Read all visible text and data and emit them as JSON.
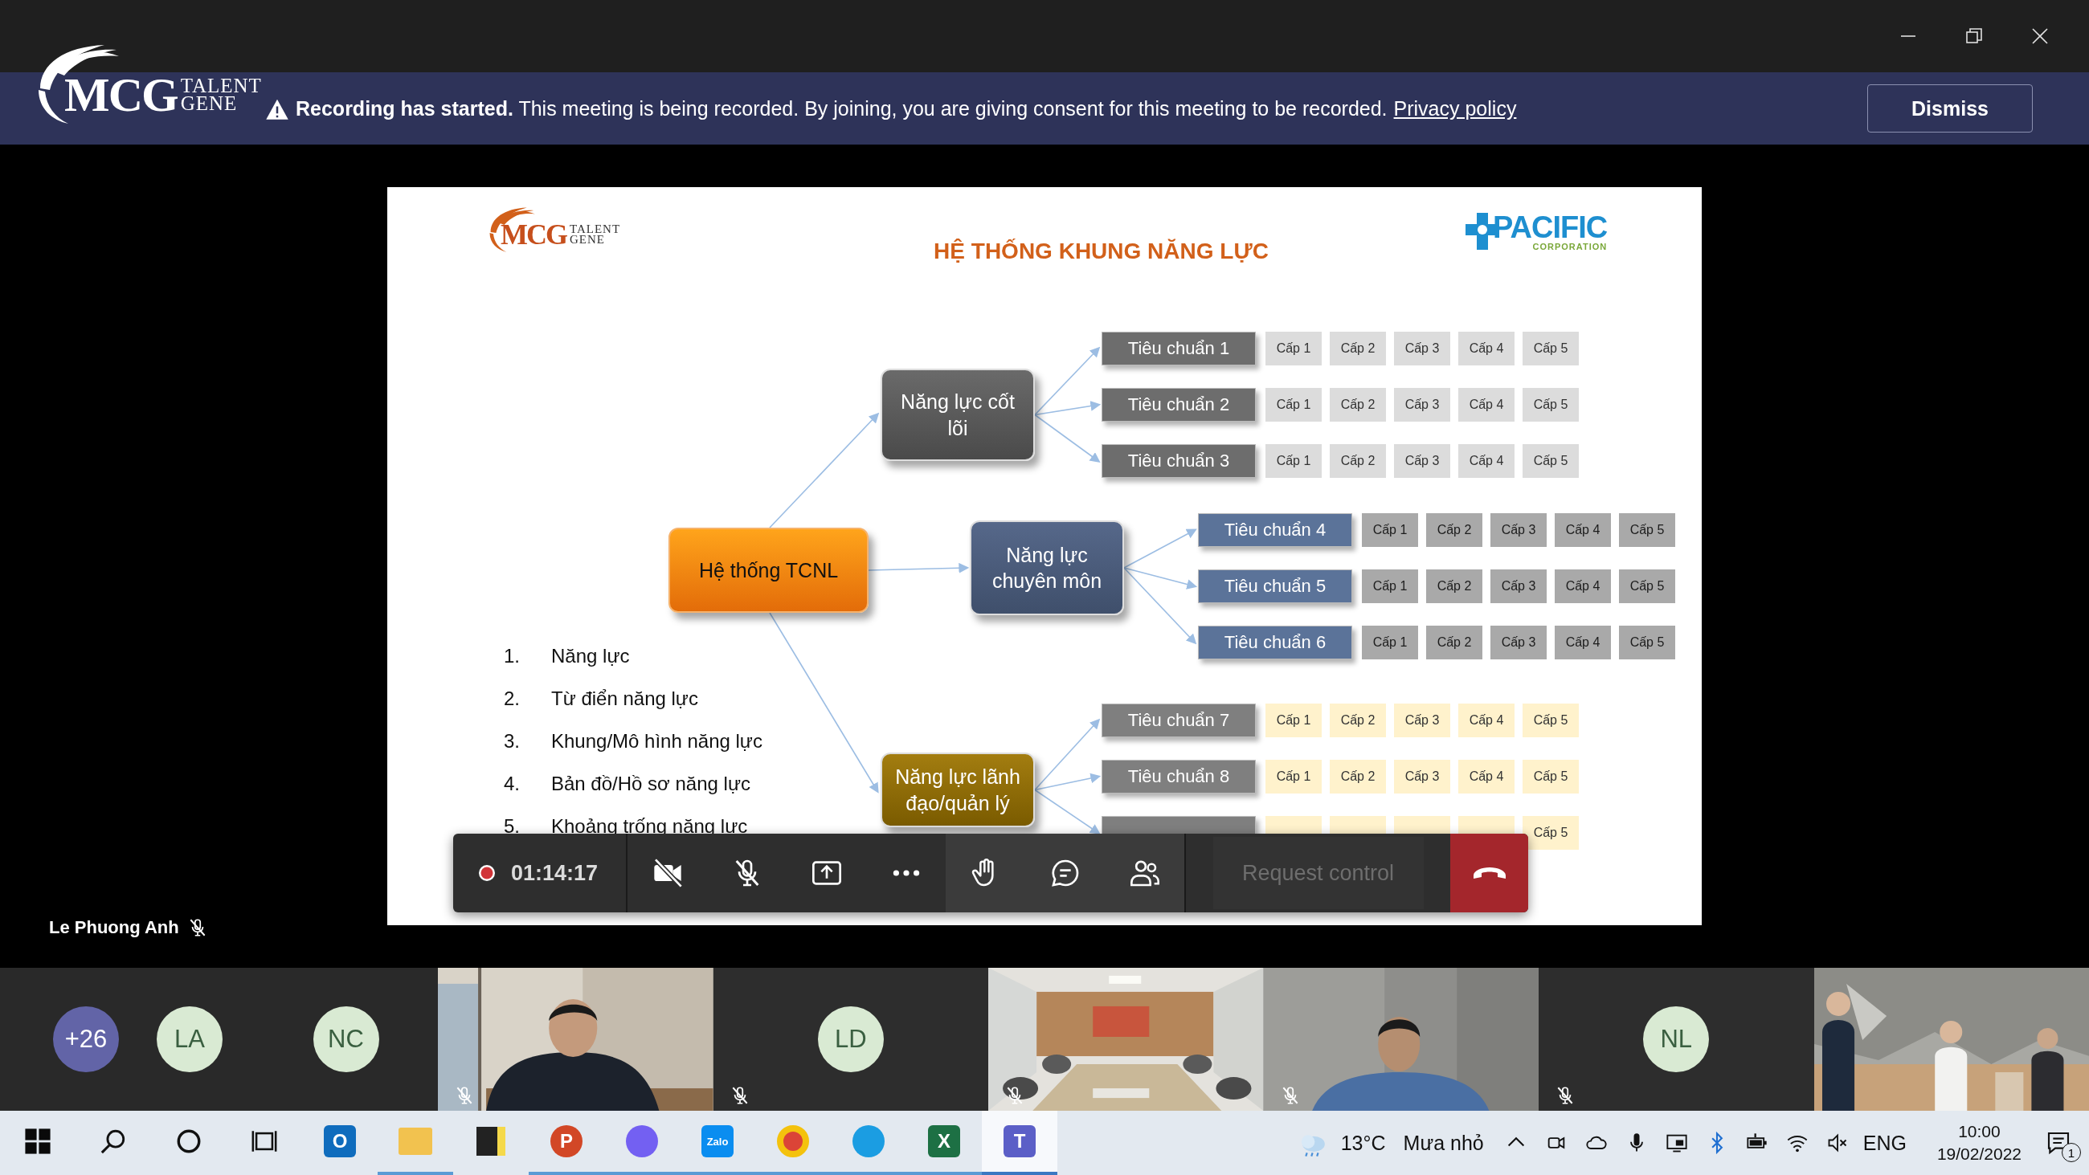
{
  "banner": {
    "logo": {
      "mark": "MCG",
      "line_1": "TALENT",
      "line_2": "GENE"
    },
    "message": "**Recording has started.** This meeting is being recorded. By joining, you are giving consent for this meeting to be recorded.",
    "link": "Privacy policy",
    "button": "Dismiss"
  },
  "slide": {
    "logo": {
      "mark": "MCG",
      "line_1": "TALENT",
      "line_2": "GENE"
    },
    "partner_logo": {
      "name": "PACIFIC",
      "tagline": "CORPORATION"
    },
    "title": "HỆ THỐNG KHUNG NĂNG LỰC",
    "diagram": {
      "root": "Hệ thống TCNL",
      "groups": [
        {
          "kind": "core",
          "label": "Năng lực cốt lõi",
          "standards": [
            {
              "label": "Tiêu chuẩn 1",
              "levels": [
                "Cấp 1",
                "Cấp 2",
                "Cấp 3",
                "Cấp 4",
                "Cấp 5"
              ]
            },
            {
              "label": "Tiêu chuẩn 2",
              "levels": [
                "Cấp 1",
                "Cấp 2",
                "Cấp 3",
                "Cấp 4",
                "Cấp 5"
              ]
            },
            {
              "label": "Tiêu chuẩn 3",
              "levels": [
                "Cấp 1",
                "Cấp 2",
                "Cấp 3",
                "Cấp 4",
                "Cấp 5"
              ]
            }
          ]
        },
        {
          "kind": "professional",
          "label": "Năng lực chuyên môn",
          "standards": [
            {
              "label": "Tiêu chuẩn 4",
              "levels": [
                "Cấp 1",
                "Cấp 2",
                "Cấp 3",
                "Cấp 4",
                "Cấp 5"
              ]
            },
            {
              "label": "Tiêu chuẩn 5",
              "levels": [
                "Cấp 1",
                "Cấp 2",
                "Cấp 3",
                "Cấp 4",
                "Cấp 5"
              ]
            },
            {
              "label": "Tiêu chuẩn 6",
              "levels": [
                "Cấp 1",
                "Cấp 2",
                "Cấp 3",
                "Cấp 4",
                "Cấp 5"
              ]
            }
          ]
        },
        {
          "kind": "leadership",
          "label": "Năng lực lãnh đạo/quản lý",
          "standards": [
            {
              "label": "Tiêu chuẩn 7",
              "levels": [
                "Cấp 1",
                "Cấp 2",
                "Cấp 3",
                "Cấp 4",
                "Cấp 5"
              ]
            },
            {
              "label": "Tiêu chuẩn 8",
              "levels": [
                "Cấp 1",
                "Cấp 2",
                "Cấp 3",
                "Cấp 4",
                "Cấp 5"
              ]
            },
            {
              "levels": [
                "Cấp 5"
              ]
            }
          ]
        }
      ]
    },
    "list": [
      {
        "number": "1.",
        "text": "Năng lực"
      },
      {
        "number": "2.",
        "text": "Từ điển năng lực"
      },
      {
        "number": "3.",
        "text": "Khung/Mô hình năng lực"
      },
      {
        "number": "4.",
        "text": "Bản đồ/Hồ sơ năng lực"
      },
      {
        "number": "5.",
        "text": "Khoảng trống năng lực"
      }
    ]
  },
  "toolbar": {
    "recording": true,
    "timer": "01:14:17",
    "camera_on": false,
    "mic_on": false,
    "request_control": {
      "label": "Request control",
      "disabled": true
    }
  },
  "speaker": {
    "name": "Le Phuong Anh",
    "muted": true
  },
  "participants": [
    {
      "kind": "overflow",
      "label": "+26"
    },
    {
      "kind": "avatar",
      "initials": "LA"
    },
    {
      "kind": "avatar",
      "initials": "NC"
    },
    {
      "kind": "video",
      "muted": true
    },
    {
      "kind": "tile",
      "initials": "LD",
      "muted": true
    },
    {
      "kind": "video",
      "muted": true
    },
    {
      "kind": "video",
      "muted": true
    },
    {
      "kind": "tile",
      "initials": "NL",
      "muted": true
    },
    {
      "kind": "video",
      "muted": false
    }
  ],
  "taskbar": {
    "apps": [
      {
        "kind": "outlook",
        "glyph": "O",
        "running": false,
        "active": false
      },
      {
        "kind": "files",
        "running": true,
        "active": false
      },
      {
        "kind": "notes",
        "running": false,
        "active": false
      },
      {
        "kind": "powerpoint",
        "glyph": "P",
        "running": true,
        "active": false
      },
      {
        "kind": "viber",
        "running": true,
        "active": false
      },
      {
        "kind": "zalo",
        "glyph": "Zalo",
        "running": true,
        "active": false
      },
      {
        "kind": "chrome",
        "running": true,
        "active": false
      },
      {
        "kind": "edge",
        "running": true,
        "active": false
      },
      {
        "kind": "excel",
        "glyph": "X",
        "running": true,
        "active": false
      },
      {
        "kind": "teams",
        "glyph": "T",
        "running": true,
        "active": true
      }
    ],
    "weather": {
      "temperature": "13°C",
      "condition": "Mưa nhỏ"
    },
    "language": "ENG",
    "time": "10:00",
    "date": "19/02/2022",
    "notification_count": "1"
  }
}
